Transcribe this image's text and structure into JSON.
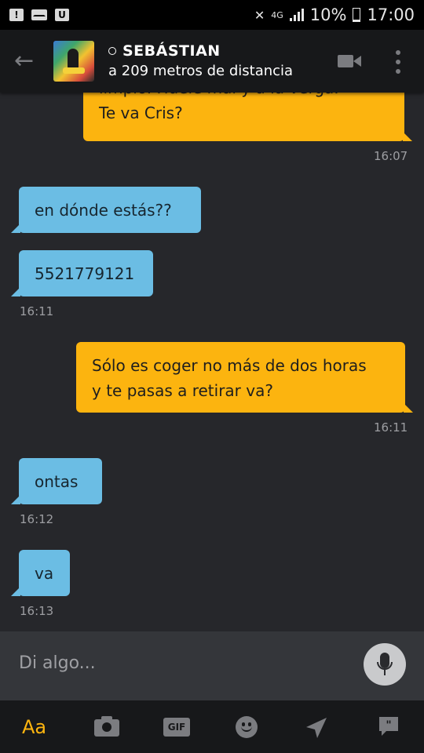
{
  "status_bar": {
    "left_icons": [
      "warning-icon",
      "mail-icon",
      "u-app-icon"
    ],
    "network": "4G",
    "battery": "10%",
    "battery_level": 0.1,
    "time": "17:00"
  },
  "header": {
    "name": "SEBÁSTIAN",
    "distance": "a 209 metros de distancia"
  },
  "messages": [
    {
      "side": "out",
      "lines": [
        "limpio. Huele mal y a la verga.",
        "Te va Cris?"
      ],
      "time": "16:07"
    },
    {
      "side": "in",
      "lines": [
        "en dónde estás??"
      ],
      "time": ""
    },
    {
      "side": "in",
      "lines": [
        "5521779121"
      ],
      "time": "16:11"
    },
    {
      "side": "out",
      "lines": [
        "Sólo es coger no más de dos horas",
        "y te pasas a retirar va?"
      ],
      "time": "16:11"
    },
    {
      "side": "in",
      "lines": [
        "ontas"
      ],
      "time": "16:12"
    },
    {
      "side": "in",
      "lines": [
        "va"
      ],
      "time": "16:13"
    }
  ],
  "input": {
    "placeholder": "Di algo..."
  },
  "toolbar": {
    "text_label": "Aa",
    "gif_label": "GIF"
  },
  "colors": {
    "outgoing": "#fcb40f",
    "incoming": "#6bbde4",
    "background": "#26272b"
  }
}
